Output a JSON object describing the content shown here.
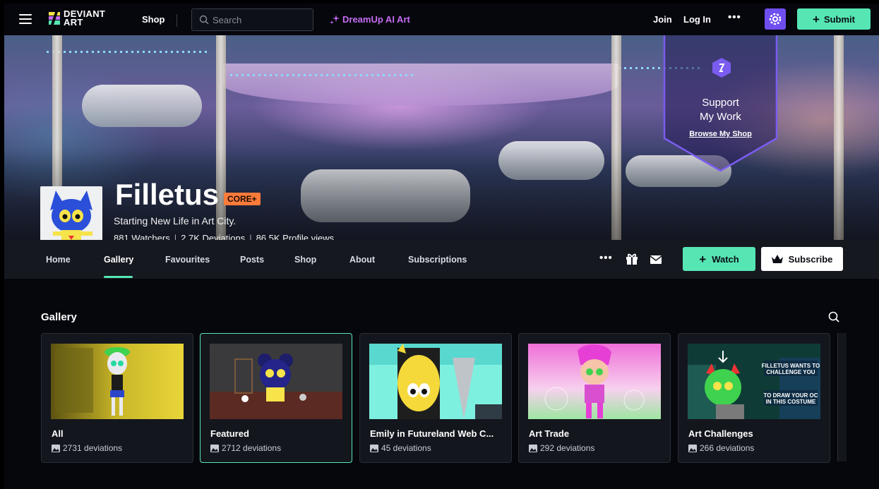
{
  "topbar": {
    "logo_text_1": "DEVIANT",
    "logo_text_2": "ART",
    "shop": "Shop",
    "search_placeholder": "Search",
    "dreamup": "DreamUp AI Art",
    "join": "Join",
    "login": "Log In",
    "more": "•••",
    "submit": "Submit"
  },
  "banner": {
    "support_line1": "Support",
    "support_line2": "My Work",
    "browse": "Browse My Shop"
  },
  "profile": {
    "name": "Filletus",
    "badge": "CORE+",
    "tagline": "Starting New Life in Art City.",
    "watchers": "881 Watchers",
    "deviations": "2.7K Deviations",
    "views": "86.5K Profile views"
  },
  "tabs": [
    {
      "label": "Home"
    },
    {
      "label": "Gallery"
    },
    {
      "label": "Favourites"
    },
    {
      "label": "Posts"
    },
    {
      "label": "Shop"
    },
    {
      "label": "About"
    },
    {
      "label": "Subscriptions"
    }
  ],
  "actions": {
    "more": "•••",
    "watch": "Watch",
    "subscribe": "Subscribe"
  },
  "gallery": {
    "title": "Gallery",
    "cards": [
      {
        "title": "All",
        "count": "2731 deviations"
      },
      {
        "title": "Featured",
        "count": "2712 deviations"
      },
      {
        "title": "Emily in Futureland Web C...",
        "count": "45 deviations"
      },
      {
        "title": "Art Trade",
        "count": "292 deviations"
      },
      {
        "title": "Art Challenges",
        "count": "266 deviations"
      }
    ],
    "challenge_thumb_text": "FILLETUS WANTS TO CHALLENGE YOU TO DRAW YOUR OC IN THIS COSTUME"
  },
  "colors": {
    "accent": "#56e6b4",
    "dreamup": "#c56df2",
    "core": "#ff7b3a",
    "gear": "#6f4ef0",
    "shield_border": "#7b5cf0"
  }
}
